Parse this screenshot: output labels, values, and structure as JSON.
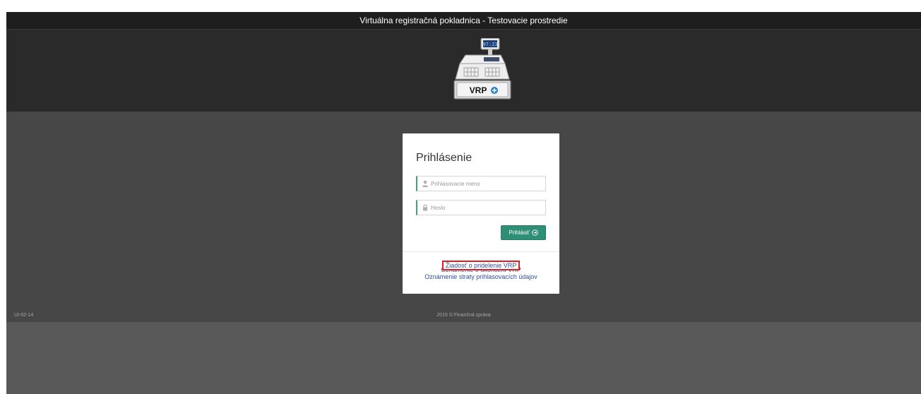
{
  "header": {
    "title": "Virtuálna registračná pokladnica - Testovacie prostredie",
    "logo_text": "VRP",
    "logo_display": "97:23"
  },
  "login": {
    "title": "Prihlásenie",
    "username_placeholder": "Prihlasovacie meno",
    "password_placeholder": "Heslo",
    "submit_label": "Prihlásiť",
    "links": [
      "Žiadosť o pridelenie VRP",
      "Oznámenie o ukončení VRP",
      "Oznámenie straty prihlasovacích údajov"
    ]
  },
  "footer": {
    "code": "UI-02-14",
    "copyright": "2015 © Finančná správa"
  },
  "colors": {
    "accent": "#2f8f76",
    "link": "#2c4f96",
    "highlight": "#e02020"
  },
  "icons": {
    "user": "user-icon",
    "lock": "lock-icon",
    "submit": "arrow-circle-right-icon"
  }
}
